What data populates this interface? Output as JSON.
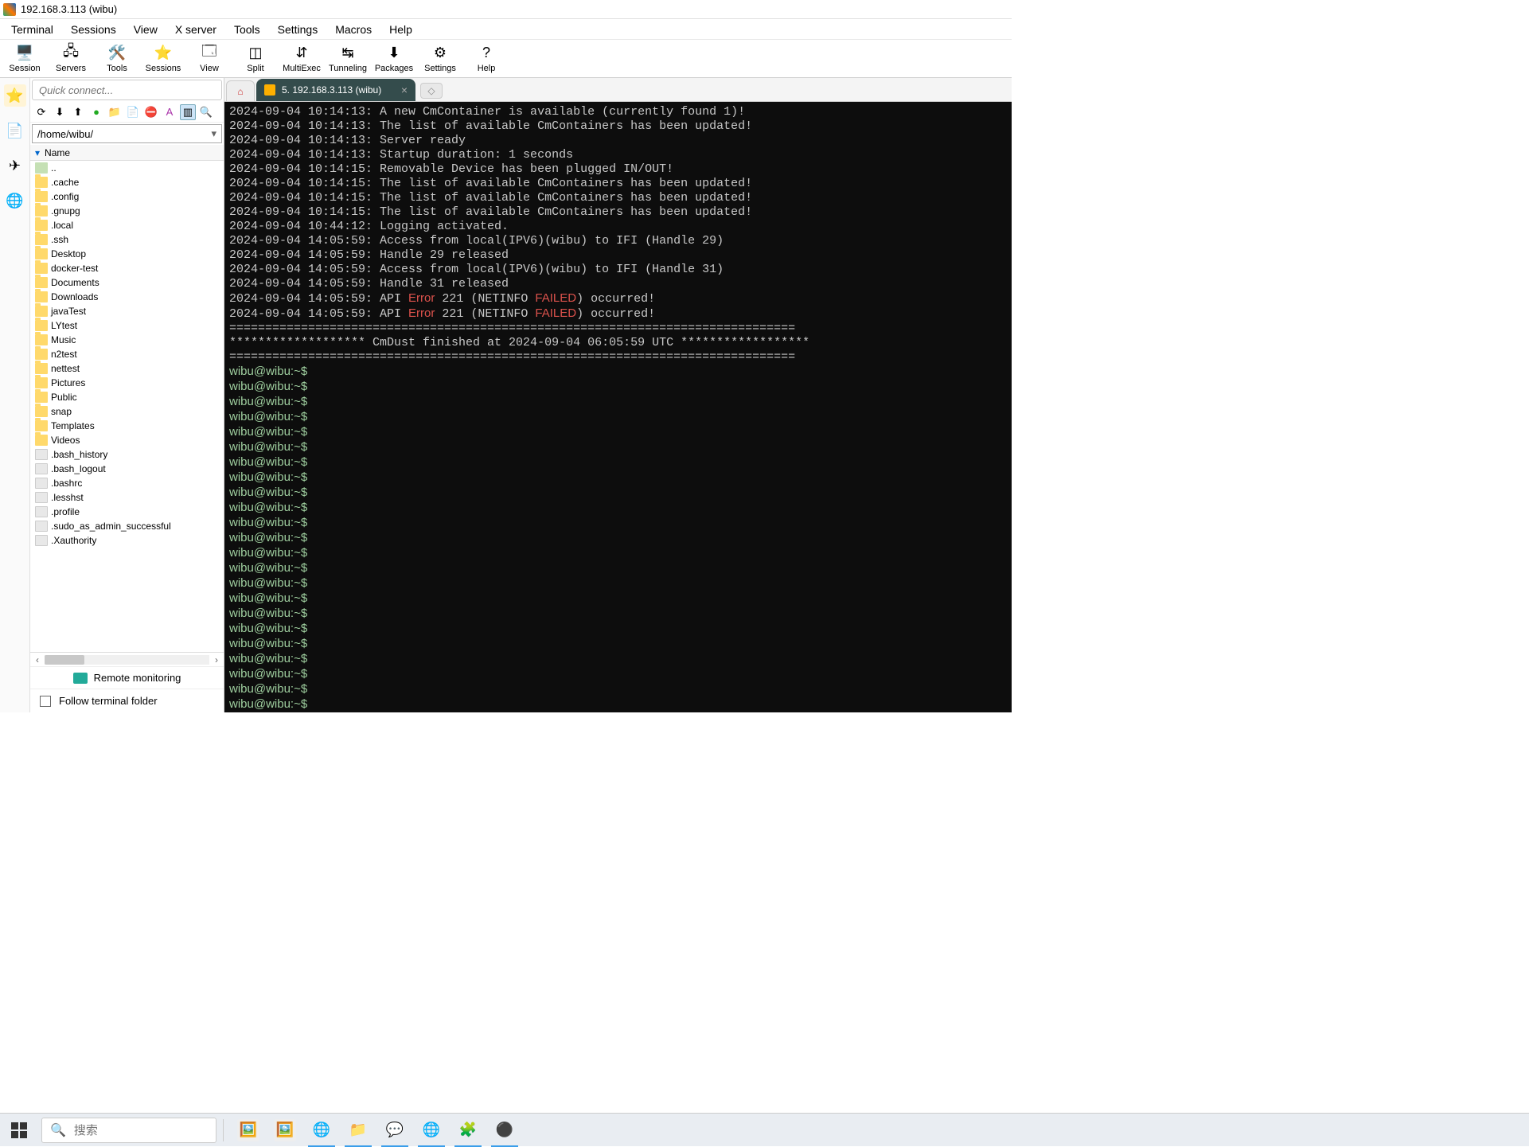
{
  "window": {
    "title": "192.168.3.113 (wibu)"
  },
  "menubar": [
    "Terminal",
    "Sessions",
    "View",
    "X server",
    "Tools",
    "Settings",
    "Macros",
    "Help"
  ],
  "toolbar": [
    {
      "label": "Session",
      "icon": "🖥️"
    },
    {
      "label": "Servers",
      "icon": "🖧"
    },
    {
      "label": "Tools",
      "icon": "🛠️"
    },
    {
      "label": "Sessions",
      "icon": "⭐"
    },
    {
      "label": "View",
      "icon": "🗔"
    },
    {
      "label": "Split",
      "icon": "◫"
    },
    {
      "label": "MultiExec",
      "icon": "⇵"
    },
    {
      "label": "Tunneling",
      "icon": "↹"
    },
    {
      "label": "Packages",
      "icon": "⬇"
    },
    {
      "label": "Settings",
      "icon": "⚙"
    },
    {
      "label": "Help",
      "icon": "?"
    }
  ],
  "quickconnect_placeholder": "Quick connect...",
  "leftstrip_icons": [
    "⭐",
    "📄",
    "✈",
    "🌐"
  ],
  "path": "/home/wibu/",
  "filelist_header": "Name",
  "files": [
    {
      "name": "..",
      "type": "parent"
    },
    {
      "name": ".cache",
      "type": "folder"
    },
    {
      "name": ".config",
      "type": "folder"
    },
    {
      "name": ".gnupg",
      "type": "folder"
    },
    {
      "name": ".local",
      "type": "folder"
    },
    {
      "name": ".ssh",
      "type": "folder"
    },
    {
      "name": "Desktop",
      "type": "folder"
    },
    {
      "name": "docker-test",
      "type": "folder"
    },
    {
      "name": "Documents",
      "type": "folder"
    },
    {
      "name": "Downloads",
      "type": "folder"
    },
    {
      "name": "javaTest",
      "type": "folder"
    },
    {
      "name": "LYtest",
      "type": "folder"
    },
    {
      "name": "Music",
      "type": "folder"
    },
    {
      "name": "n2test",
      "type": "folder"
    },
    {
      "name": "nettest",
      "type": "folder"
    },
    {
      "name": "Pictures",
      "type": "folder"
    },
    {
      "name": "Public",
      "type": "folder"
    },
    {
      "name": "snap",
      "type": "folder"
    },
    {
      "name": "Templates",
      "type": "folder"
    },
    {
      "name": "Videos",
      "type": "folder"
    },
    {
      "name": ".bash_history",
      "type": "file"
    },
    {
      "name": ".bash_logout",
      "type": "file"
    },
    {
      "name": ".bashrc",
      "type": "file"
    },
    {
      "name": ".lesshst",
      "type": "file"
    },
    {
      "name": ".profile",
      "type": "file"
    },
    {
      "name": ".sudo_as_admin_successful",
      "type": "file"
    },
    {
      "name": ".Xauthority",
      "type": "file"
    }
  ],
  "remote_monitoring": "Remote monitoring",
  "follow_terminal": "Follow terminal folder",
  "tab": {
    "label": "5. 192.168.3.113 (wibu)"
  },
  "terminal": {
    "log_lines": [
      {
        "ts": "2024-09-04 10:14:13:",
        "msg": " A new CmContainer is available (currently found 1)!"
      },
      {
        "ts": "2024-09-04 10:14:13:",
        "msg": " The list of available CmContainers has been updated!"
      },
      {
        "ts": "2024-09-04 10:14:13:",
        "msg": " Server ready"
      },
      {
        "ts": "2024-09-04 10:14:13:",
        "msg": " Startup duration: 1 seconds"
      },
      {
        "ts": "2024-09-04 10:14:15:",
        "msg": " Removable Device has been plugged IN/OUT!"
      },
      {
        "ts": "2024-09-04 10:14:15:",
        "msg": " The list of available CmContainers has been updated!"
      },
      {
        "ts": "2024-09-04 10:14:15:",
        "msg": " The list of available CmContainers has been updated!"
      },
      {
        "ts": "2024-09-04 10:14:15:",
        "msg": " The list of available CmContainers has been updated!"
      },
      {
        "ts": "2024-09-04 10:44:12:",
        "msg": " Logging activated."
      },
      {
        "ts": "2024-09-04 14:05:59:",
        "msg": " Access from local(IPV6)(wibu) to IFI (Handle 29)"
      },
      {
        "ts": "2024-09-04 14:05:59:",
        "msg": " Handle 29 released"
      },
      {
        "ts": "2024-09-04 14:05:59:",
        "msg": " Access from local(IPV6)(wibu) to IFI (Handle 31)"
      },
      {
        "ts": "2024-09-04 14:05:59:",
        "msg": " Handle 31 released"
      }
    ],
    "error_lines": [
      {
        "ts": "2024-09-04 14:05:59:",
        "p1": " API ",
        "err1": "Error",
        "p2": " 221 (NETINFO ",
        "err2": "FAILED",
        "p3": ") occurred!"
      },
      {
        "ts": "2024-09-04 14:05:59:",
        "p1": " API ",
        "err1": "Error",
        "p2": " 221 (NETINFO ",
        "err2": "FAILED",
        "p3": ") occurred!"
      }
    ],
    "sep": "===============================================================================",
    "finished": "******************* CmDust finished at 2024-09-04 06:05:59 UTC ******************",
    "prompt": "wibu@wibu:~$",
    "prompt_count": 24
  },
  "taskbar": {
    "search_placeholder": "搜索",
    "apps": [
      "🖼️",
      "🖼️",
      "🌐",
      "📁",
      "💬",
      "🌐",
      "🧩",
      "⚫"
    ]
  }
}
